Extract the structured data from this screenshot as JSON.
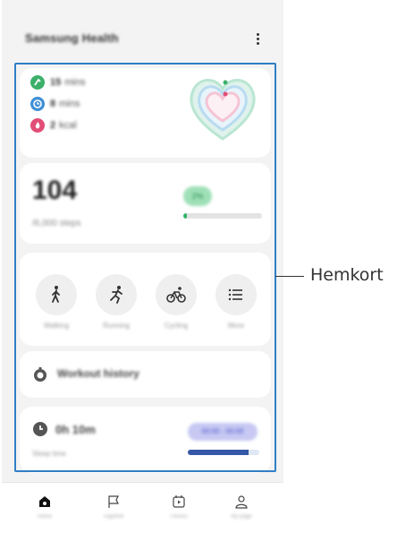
{
  "app": {
    "title": "Samsung Health"
  },
  "activity": {
    "metrics": [
      {
        "value": "15",
        "unit": "mins",
        "color": "#3cb06b"
      },
      {
        "value": "8",
        "unit": "mins",
        "color": "#3d8fd6"
      },
      {
        "value": "2",
        "unit": "kcal",
        "color": "#e24d76"
      }
    ]
  },
  "steps": {
    "value": "104",
    "label": "/6,000 steps",
    "badge": "2%",
    "progress": 0.02,
    "color": "#2fb36a"
  },
  "workouts": {
    "items": [
      {
        "label": "Walking",
        "icon": "walking-icon"
      },
      {
        "label": "Running",
        "icon": "running-icon"
      },
      {
        "label": "Cycling",
        "icon": "cycling-icon"
      },
      {
        "label": "More",
        "icon": "list-icon"
      }
    ]
  },
  "history": {
    "label": "Workout history"
  },
  "sleep": {
    "time": "0h 10m",
    "label": "Sleep time",
    "badge": "00:00 - 00:00",
    "progress": 0.85
  },
  "nav": {
    "items": [
      {
        "label": "Home",
        "icon": "home-icon"
      },
      {
        "label": "Together",
        "icon": "flag-icon"
      },
      {
        "label": "Fitness",
        "icon": "play-calendar-icon"
      },
      {
        "label": "My page",
        "icon": "person-icon"
      }
    ]
  },
  "callout": {
    "label": "Hemkort"
  }
}
